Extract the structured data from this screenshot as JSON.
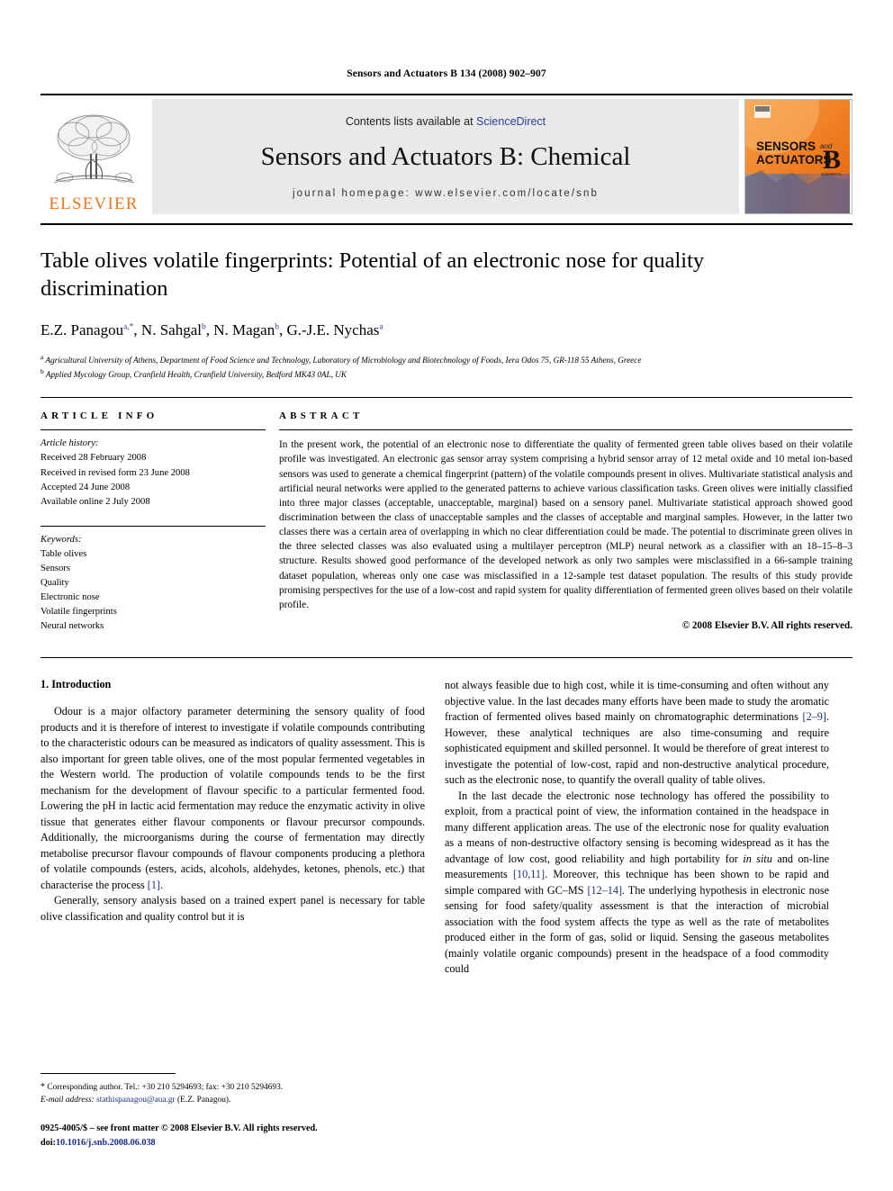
{
  "running_head": "Sensors and Actuators B 134 (2008) 902–907",
  "journal_header": {
    "contents_prefix": "Contents lists available at ",
    "sciencedirect": "ScienceDirect",
    "journal_title": "Sensors and Actuators B: Chemical",
    "homepage": "journal homepage: www.elsevier.com/locate/snb",
    "publisher_wordmark": "ELSEVIER",
    "cover": {
      "line1": "SENSORS",
      "line1_suffix": "and",
      "line2": "ACTUATORS",
      "volume_letter": "B",
      "volume_sub": "CHEMICAL"
    }
  },
  "article": {
    "title": "Table olives volatile fingerprints: Potential of an electronic nose for quality discrimination",
    "authors_html": "E.Z. Panagou, N. Sahgal, N. Magan, G.-J.E. Nychas",
    "authors": [
      {
        "name": "E.Z. Panagou",
        "marks": "a,*"
      },
      {
        "name": "N. Sahgal",
        "marks": "b"
      },
      {
        "name": "N. Magan",
        "marks": "b"
      },
      {
        "name": "G.-J.E. Nychas",
        "marks": "a"
      }
    ],
    "affiliations": [
      {
        "mark": "a",
        "text": "Agricultural University of Athens, Department of Food Science and Technology, Laboratory of Microbiology and Biotechnology of Foods, Iera Odos 75, GR-118 55 Athens, Greece"
      },
      {
        "mark": "b",
        "text": "Applied Mycology Group, Cranfield Health, Cranfield University, Bedford MK43 0AL, UK"
      }
    ]
  },
  "article_info": {
    "heading": "ARTICLE INFO",
    "history_label": "Article history:",
    "history": [
      "Received 28 February 2008",
      "Received in revised form 23 June 2008",
      "Accepted 24 June 2008",
      "Available online 2 July 2008"
    ],
    "keywords_label": "Keywords:",
    "keywords": [
      "Table olives",
      "Sensors",
      "Quality",
      "Electronic nose",
      "Volatile fingerprints",
      "Neural networks"
    ]
  },
  "abstract": {
    "heading": "ABSTRACT",
    "text": "In the present work, the potential of an electronic nose to differentiate the quality of fermented green table olives based on their volatile profile was investigated. An electronic gas sensor array system comprising a hybrid sensor array of 12 metal oxide and 10 metal ion-based sensors was used to generate a chemical fingerprint (pattern) of the volatile compounds present in olives. Multivariate statistical analysis and artificial neural networks were applied to the generated patterns to achieve various classification tasks. Green olives were initially classified into three major classes (acceptable, unacceptable, marginal) based on a sensory panel. Multivariate statistical approach showed good discrimination between the class of unacceptable samples and the classes of acceptable and marginal samples. However, in the latter two classes there was a certain area of overlapping in which no clear differentiation could be made. The potential to discriminate green olives in the three selected classes was also evaluated using a multilayer perceptron (MLP) neural network as a classifier with an 18–15–8–3 structure. Results showed good performance of the developed network as only two samples were misclassified in a 66-sample training dataset population, whereas only one case was misclassified in a 12-sample test dataset population. The results of this study provide promising perspectives for the use of a low-cost and rapid system for quality differentiation of fermented green olives based on their volatile profile.",
    "copyright": "© 2008 Elsevier B.V. All rights reserved."
  },
  "introduction": {
    "heading": "1. Introduction",
    "left_paragraph_1": "Odour is a major olfactory parameter determining the sensory quality of food products and it is therefore of interest to investigate if volatile compounds contributing to the characteristic odours can be measured as indicators of quality assessment. This is also important for green table olives, one of the most popular fermented vegetables in the Western world. The production of volatile compounds tends to be the first mechanism for the development of flavour specific to a particular fermented food. Lowering the pH in lactic acid fermentation may reduce the enzymatic activity in olive tissue that generates either flavour components or flavour precursor compounds. Additionally, the microorganisms during the course of fermentation may directly metabolise precursor flavour compounds of flavour components producing a plethora of volatile compounds (esters, acids, alcohols, aldehydes, ketones, phenols, etc.) that characterise the process ",
    "left_paragraph_1_cite": "[1]",
    "left_paragraph_1_end": ".",
    "left_paragraph_2": "Generally, sensory analysis based on a trained expert panel is necessary for table olive classification and quality control but it is",
    "right_paragraph_1_a": "not always feasible due to high cost, while it is time-consuming and often without any objective value. In the last decades many efforts have been made to study the aromatic fraction of fermented olives based mainly on chromatographic determinations ",
    "right_cite_1": "[2–9]",
    "right_paragraph_1_b": ". However, these analytical techniques are also time-consuming and require sophisticated equipment and skilled personnel. It would be therefore of great interest to investigate the potential of low-cost, rapid and non-destructive analytical procedure, such as the electronic nose, to quantify the overall quality of table olives.",
    "right_paragraph_2_a": "In the last decade the electronic nose technology has offered the possibility to exploit, from a practical point of view, the information contained in the headspace in many different application areas. The use of the electronic nose for quality evaluation as a means of non-destructive olfactory sensing is becoming widespread as it has the advantage of low cost, good reliability and high portability for ",
    "right_italic_1": "in situ",
    "right_paragraph_2_b": " and on-line measurements ",
    "right_cite_2": "[10,11]",
    "right_paragraph_2_c": ". Moreover, this technique has been shown to be rapid and simple compared with GC–MS ",
    "right_cite_3": "[12–14]",
    "right_paragraph_2_d": ". The underlying hypothesis in electronic nose sensing for food safety/quality assessment is that the interaction of microbial association with the food system affects the type as well as the rate of metabolites produced either in the form of gas, solid or liquid. Sensing the gaseous metabolites (mainly volatile organic compounds) present in the headspace of a food commodity could"
  },
  "footnote": {
    "star": "*",
    "corresponding": "Corresponding author. Tel.: +30 210 5294693; fax: +30 210 5294693.",
    "email_label": "E-mail address:",
    "email": "stathispanagou@aua.gr",
    "email_owner": "(E.Z. Panagou)."
  },
  "footer": {
    "front_matter": "0925-4005/$ – see front matter © 2008 Elsevier B.V. All rights reserved.",
    "doi_label": "doi:",
    "doi": "10.1016/j.snb.2008.06.038"
  },
  "colors": {
    "elsevier_orange": "#E87722",
    "link_blue": "#1a2f86",
    "sciencedirect_blue": "#2b3f9e",
    "band_gray": "#e9e9e9"
  }
}
